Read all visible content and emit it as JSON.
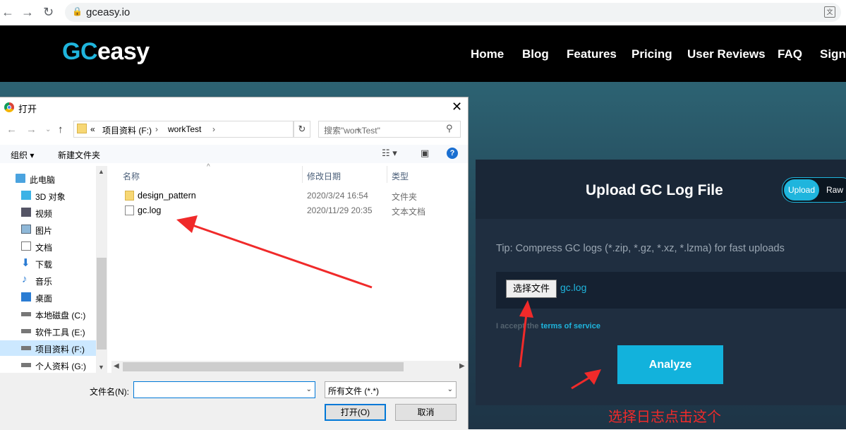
{
  "browser": {
    "url": "gceasy.io"
  },
  "site": {
    "logo_gc": "GC",
    "logo_easy": "easy",
    "nav": [
      "Home",
      "Blog",
      "Features",
      "Pricing",
      "User Reviews",
      "FAQ",
      "Sign"
    ]
  },
  "upload_panel": {
    "title": "Upload GC Log File",
    "toggle_upload": "Upload",
    "toggle_raw": "Raw",
    "tip": "Tip: Compress GC logs (*.zip, *.gz, *.xz, *.lzma) for fast uploads",
    "choose_file_label": "选择文件",
    "chosen_file": "gc.log",
    "accept_prefix": "I accept the ",
    "terms_link": "terms of service",
    "analyze_label": "Analyze",
    "accent_color": "#12b2dc"
  },
  "annotation": {
    "text": "选择日志点击这个",
    "color": "#f02a2a"
  },
  "dialog": {
    "title": "打开",
    "breadcrumbs": [
      "«",
      "项目资料 (F:)",
      "workTest"
    ],
    "search_placeholder": "搜索\"workTest\"",
    "toolbar": {
      "organize": "组织 ▾",
      "new_folder": "新建文件夹"
    },
    "nav_items": [
      {
        "label": "此电脑",
        "icon": "computer-icon"
      },
      {
        "label": "3D 对象",
        "icon": "3d-objects-icon"
      },
      {
        "label": "视频",
        "icon": "video-icon"
      },
      {
        "label": "图片",
        "icon": "pictures-icon"
      },
      {
        "label": "文档",
        "icon": "documents-icon"
      },
      {
        "label": "下载",
        "icon": "download-icon"
      },
      {
        "label": "音乐",
        "icon": "music-icon"
      },
      {
        "label": "桌面",
        "icon": "desktop-icon"
      },
      {
        "label": "本地磁盘 (C:)",
        "icon": "drive-icon"
      },
      {
        "label": "软件工具 (E:)",
        "icon": "drive-icon"
      },
      {
        "label": "项目资料 (F:)",
        "icon": "drive-icon",
        "selected": true
      },
      {
        "label": "个人资料 (G:)",
        "icon": "drive-icon"
      }
    ],
    "columns": [
      "名称",
      "修改日期",
      "类型"
    ],
    "files": [
      {
        "name": "design_pattern",
        "date": "2020/3/24 16:54",
        "type": "文件夹",
        "icon": "folder-icon"
      },
      {
        "name": "gc.log",
        "date": "2020/11/29 20:35",
        "type": "文本文档",
        "icon": "text-file-icon"
      }
    ],
    "filename_label": "文件名(N):",
    "filename_value": "",
    "filter": "所有文件 (*.*)",
    "open_label": "打开(O)",
    "cancel_label": "取消"
  }
}
